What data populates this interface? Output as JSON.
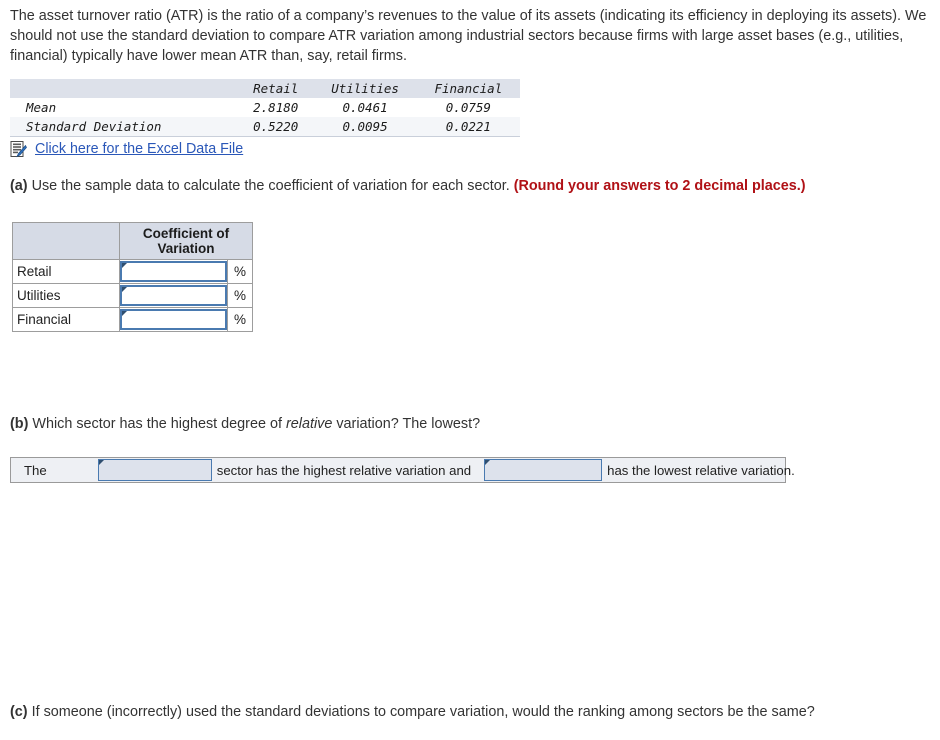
{
  "intro": {
    "text": "The asset turnover ratio (ATR) is the ratio of a company’s revenues to the value of its assets (indicating its efficiency in deploying its assets). We should not use the standard deviation to compare ATR variation among industrial sectors because firms with large asset bases (e.g., utilities, financial) typically have lower mean ATR than, say, retail firms."
  },
  "stats_table": {
    "corner_label": "",
    "columns": [
      "Retail",
      "Utilities",
      "Financial"
    ],
    "rows": [
      {
        "label": "Mean",
        "values": [
          "2.8180",
          "0.0461",
          "0.0759"
        ]
      },
      {
        "label": "Standard Deviation",
        "values": [
          "0.5220",
          "0.0095",
          "0.0221"
        ]
      }
    ]
  },
  "excel": {
    "icon": "excel-document-icon",
    "link_label": "Click here for the Excel Data File"
  },
  "part_a": {
    "tag": "(a)",
    "text": "Use the sample data to calculate the coefficient of variation for each sector.",
    "hint": "(Round your answers to 2 decimal places.)",
    "table": {
      "blank_header": "",
      "value_header": "Coefficient of Variation",
      "unit_suffix": "%",
      "rows": [
        {
          "label": "Retail",
          "value": "",
          "unit": "%"
        },
        {
          "label": "Utilities",
          "value": "",
          "unit": "%"
        },
        {
          "label": "Financial",
          "value": "",
          "unit": "%"
        }
      ]
    }
  },
  "part_b": {
    "tag": "(b)",
    "text_before_italic": "Which sector has the highest degree of ",
    "italic_word": "relative",
    "text_after_italic": " variation? The lowest?",
    "sentence": {
      "lead": "The",
      "dropdown_highest": "",
      "middle": "sector has the highest relative variation and",
      "dropdown_lowest": "",
      "tail": "has the lowest relative variation."
    }
  },
  "part_c": {
    "tag": "(c)",
    "text": "If someone (incorrectly) used the standard deviations to compare variation, would the ranking among sectors be the same?"
  },
  "colors": {
    "link": "#2a57b8",
    "hint": "#b01116",
    "input_border": "#4a7ab0",
    "header_fill": "#d6dbe6",
    "stats_header_fill": "#dde1ea",
    "sentence_bar_fill": "#eef0f4"
  }
}
